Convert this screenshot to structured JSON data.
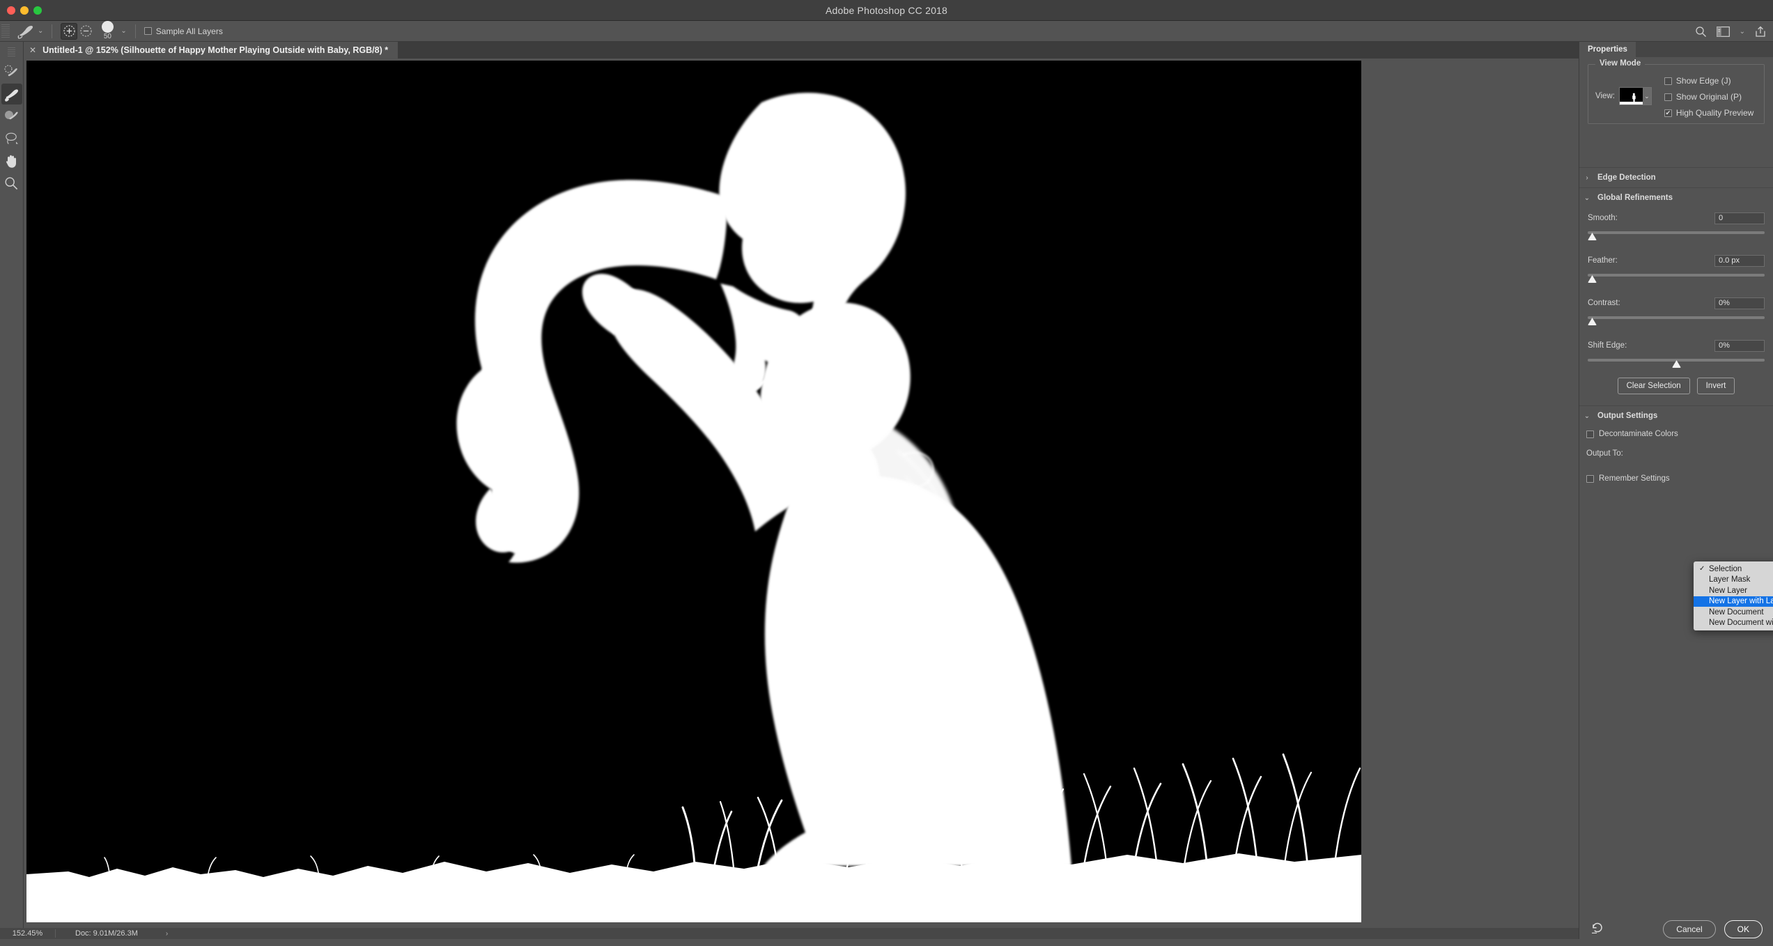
{
  "window": {
    "app_title": "Adobe Photoshop CC 2018",
    "traffic_lights": [
      "close-button",
      "minimize-button",
      "maximize-button"
    ]
  },
  "options_bar": {
    "tool_icon": "refine-edge-brush-icon",
    "tool_preset_chevron": "chevron-down-icon",
    "add_mode_icon": "plus-circle-icon",
    "subtract_mode_icon": "minus-circle-icon",
    "brush_size": "50",
    "brush_chevron": "chevron-down-icon",
    "sample_all_layers_label": "Sample All Layers",
    "sample_all_layers_checked": false,
    "right_icons": [
      "search-icon",
      "workspace-icon",
      "chevron-down-icon",
      "share-icon"
    ]
  },
  "toolbar": {
    "items": [
      {
        "name": "quick-selection-tool",
        "active": false
      },
      {
        "name": "refine-edge-brush-tool",
        "active": true
      },
      {
        "name": "brush-tool",
        "active": false
      },
      {
        "name": "lasso-tool",
        "active": false
      },
      {
        "name": "hand-tool",
        "active": false
      },
      {
        "name": "zoom-tool",
        "active": false
      }
    ]
  },
  "document": {
    "tab_close": "✕",
    "tab_title": "Untitled-1 @ 152% (Silhouette of Happy Mother Playing Outside with Baby, RGB/8) *"
  },
  "status_bar": {
    "zoom": "152.45%",
    "doc_info": "Doc: 9.01M/26.3M",
    "chevron": "›"
  },
  "panel": {
    "tab_label": "Properties",
    "view_mode": {
      "legend": "View Mode",
      "view_label": "View:",
      "thumbnail_name": "view-preview-thumbnail",
      "dropdown_icon": "chevron-down-icon",
      "options": [
        {
          "label": "Show Edge (J)",
          "checked": false
        },
        {
          "label": "Show Original (P)",
          "checked": false
        },
        {
          "label": "High Quality Preview",
          "checked": true
        }
      ]
    },
    "edge_detection": {
      "label": "Edge Detection",
      "expanded": false,
      "arrow": "›"
    },
    "global_refinements": {
      "label": "Global Refinements",
      "expanded": true,
      "arrow": "⌄",
      "sliders": [
        {
          "label": "Smooth:",
          "value": "0",
          "position_pct": 0
        },
        {
          "label": "Feather:",
          "value": "0.0 px",
          "position_pct": 0
        },
        {
          "label": "Contrast:",
          "value": "0%",
          "position_pct": 0
        },
        {
          "label": "Shift Edge:",
          "value": "0%",
          "position_pct": 50
        }
      ],
      "clear_selection_label": "Clear Selection",
      "invert_label": "Invert"
    },
    "output_settings": {
      "label": "Output Settings",
      "expanded": true,
      "arrow": "⌄",
      "decontaminate_label": "Decontaminate Colors",
      "decontaminate_checked": false,
      "output_to_label": "Output To:",
      "remember_label": "Remember Settings",
      "remember_checked": false,
      "dropdown_open": true,
      "dropdown_options": [
        {
          "label": "Selection",
          "checked": true,
          "highlighted": false
        },
        {
          "label": "Layer Mask",
          "checked": false,
          "highlighted": false
        },
        {
          "label": "New Layer",
          "checked": false,
          "highlighted": false
        },
        {
          "label": "New Layer with Layer Mask",
          "checked": false,
          "highlighted": true
        },
        {
          "label": "New Document",
          "checked": false,
          "highlighted": false
        },
        {
          "label": "New Document with Layer Mask",
          "checked": false,
          "highlighted": false
        }
      ]
    },
    "footer": {
      "reset_icon": "reset-icon",
      "cancel_label": "Cancel",
      "ok_label": "OK"
    }
  },
  "colors": {
    "panel_bg": "#535353",
    "titlebar_bg": "#3f3f3f",
    "highlight_blue": "#1473e6",
    "canvas_bg": "#000000",
    "mask_white": "#ffffff"
  }
}
